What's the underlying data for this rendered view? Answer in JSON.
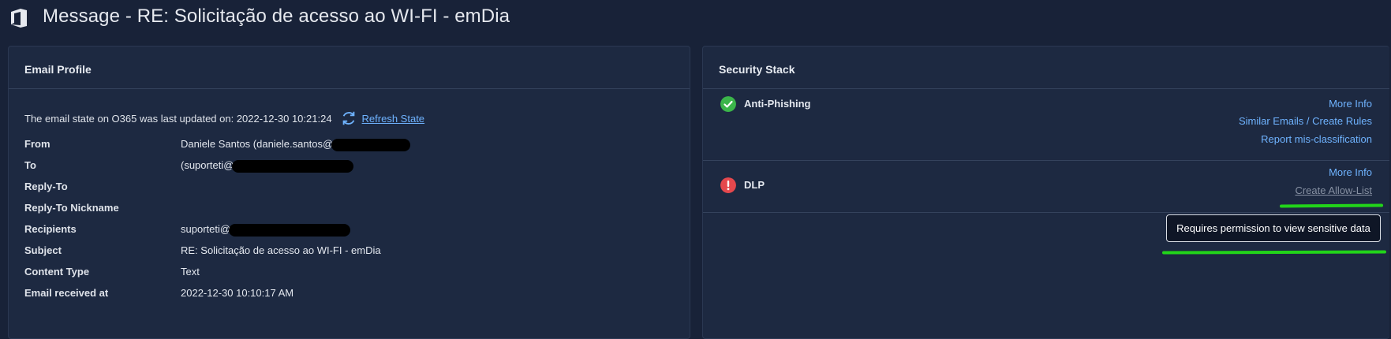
{
  "window": {
    "title": "Message - RE: Solicitação de acesso ao WI-FI  - emDia"
  },
  "email_profile": {
    "header": "Email Profile",
    "state_text": "The email state on O365 was last updated on: 2022-12-30 10:21:24",
    "refresh_label": "Refresh State",
    "fields": [
      {
        "label": "From",
        "value": "Daniele Santos (daniele.santos@"
      },
      {
        "label": "To",
        "value": "(suporteti@"
      },
      {
        "label": "Reply-To",
        "value": ""
      },
      {
        "label": "Reply-To Nickname",
        "value": ""
      },
      {
        "label": "Recipients",
        "value": "suporteti@"
      },
      {
        "label": "Subject",
        "value": "RE: Solicitação de acesso ao WI-FI  - emDia"
      },
      {
        "label": "Content Type",
        "value": "Text"
      },
      {
        "label": "Email received at",
        "value": "2022-12-30 10:10:17 AM"
      }
    ]
  },
  "security_stack": {
    "header": "Security Stack",
    "items": [
      {
        "name": "Anti-Phishing",
        "status_icon": "check-circle-icon",
        "status_color": "#3bb54a",
        "links": [
          "More Info",
          "Similar Emails / Create Rules",
          "Report mis-classification"
        ]
      },
      {
        "name": "DLP",
        "status_icon": "alert-circle-icon",
        "status_color": "#e5484d",
        "links": [
          "More Info",
          "Create Allow-List"
        ]
      }
    ],
    "tooltip": "Requires permission to view sensitive data"
  },
  "colors": {
    "link": "#6fb3ff",
    "highlight": "#22d41a",
    "background": "#182238"
  }
}
